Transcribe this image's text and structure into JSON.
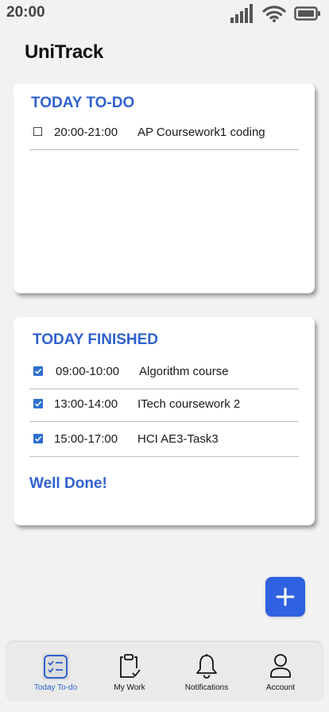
{
  "status_bar": {
    "time": "20:00"
  },
  "app": {
    "title": "UniTrack"
  },
  "todo_card": {
    "title": "TODAY TO-DO",
    "tasks": [
      {
        "time": "20:00-21:00",
        "name": "AP Coursework1 coding",
        "checked": false
      }
    ]
  },
  "finished_card": {
    "title": "TODAY FINISHED",
    "tasks": [
      {
        "time": "09:00-10:00",
        "name": "Algorithm course",
        "checked": true
      },
      {
        "time": "13:00-14:00",
        "name": "ITech coursework 2",
        "checked": true
      },
      {
        "time": "15:00-17:00",
        "name": "HCI AE3-Task3",
        "checked": true
      }
    ],
    "footer": "Well Done!"
  },
  "fab": {
    "icon": "plus-icon"
  },
  "bottom_nav": {
    "items": [
      {
        "label": "Today To-do",
        "icon": "checklist-icon",
        "active": true
      },
      {
        "label": "My Work",
        "icon": "clipboard-icon",
        "active": false
      },
      {
        "label": "Notifications",
        "icon": "bell-icon",
        "active": false
      },
      {
        "label": "Account",
        "icon": "person-icon",
        "active": false
      }
    ]
  },
  "colors": {
    "accent": "#2f62d0",
    "fab": "#2f62e0",
    "background": "#f2f2f2",
    "card": "#ffffff"
  }
}
